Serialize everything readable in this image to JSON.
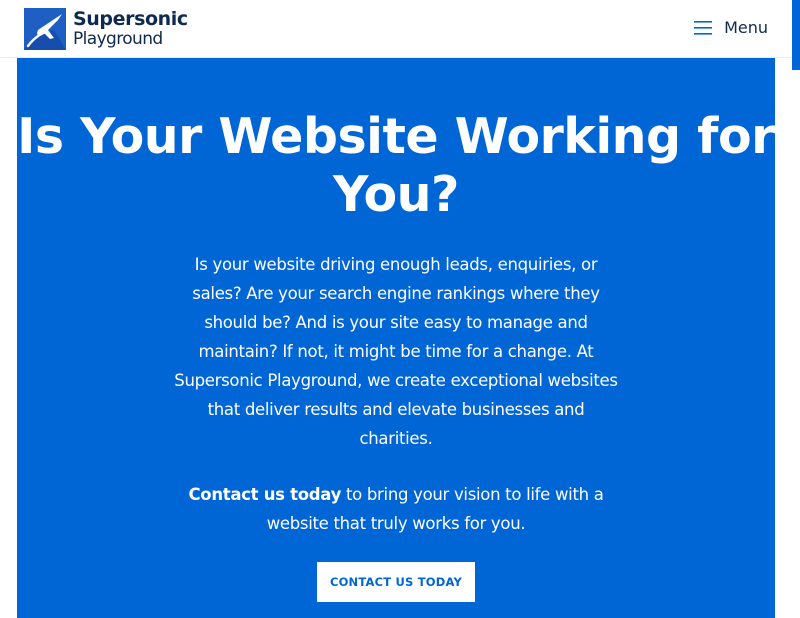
{
  "header": {
    "logo": {
      "line1": "Supersonic",
      "line2": "Playground",
      "icon": "plane-logo-icon"
    },
    "menu": {
      "label": "Menu",
      "icon": "hamburger-icon"
    }
  },
  "hero": {
    "title": "Is Your Website Working for You?",
    "body": "Is your website driving enough leads, enquiries, or sales? Are your search engine rankings where they should be? And is your site easy to manage and maintain? If not, it might be time for a change. At Supersonic Playground, we create exceptional websites that deliver results and elevate businesses and charities.",
    "cta_link_text": "Contact us today",
    "cta_rest_text": " to bring your vision to life with a website that truly works for you.",
    "button_label": "CONTACT US TODAY"
  },
  "colors": {
    "brand_blue": "#0066d6",
    "navy": "#0e2a4f",
    "white": "#ffffff"
  }
}
